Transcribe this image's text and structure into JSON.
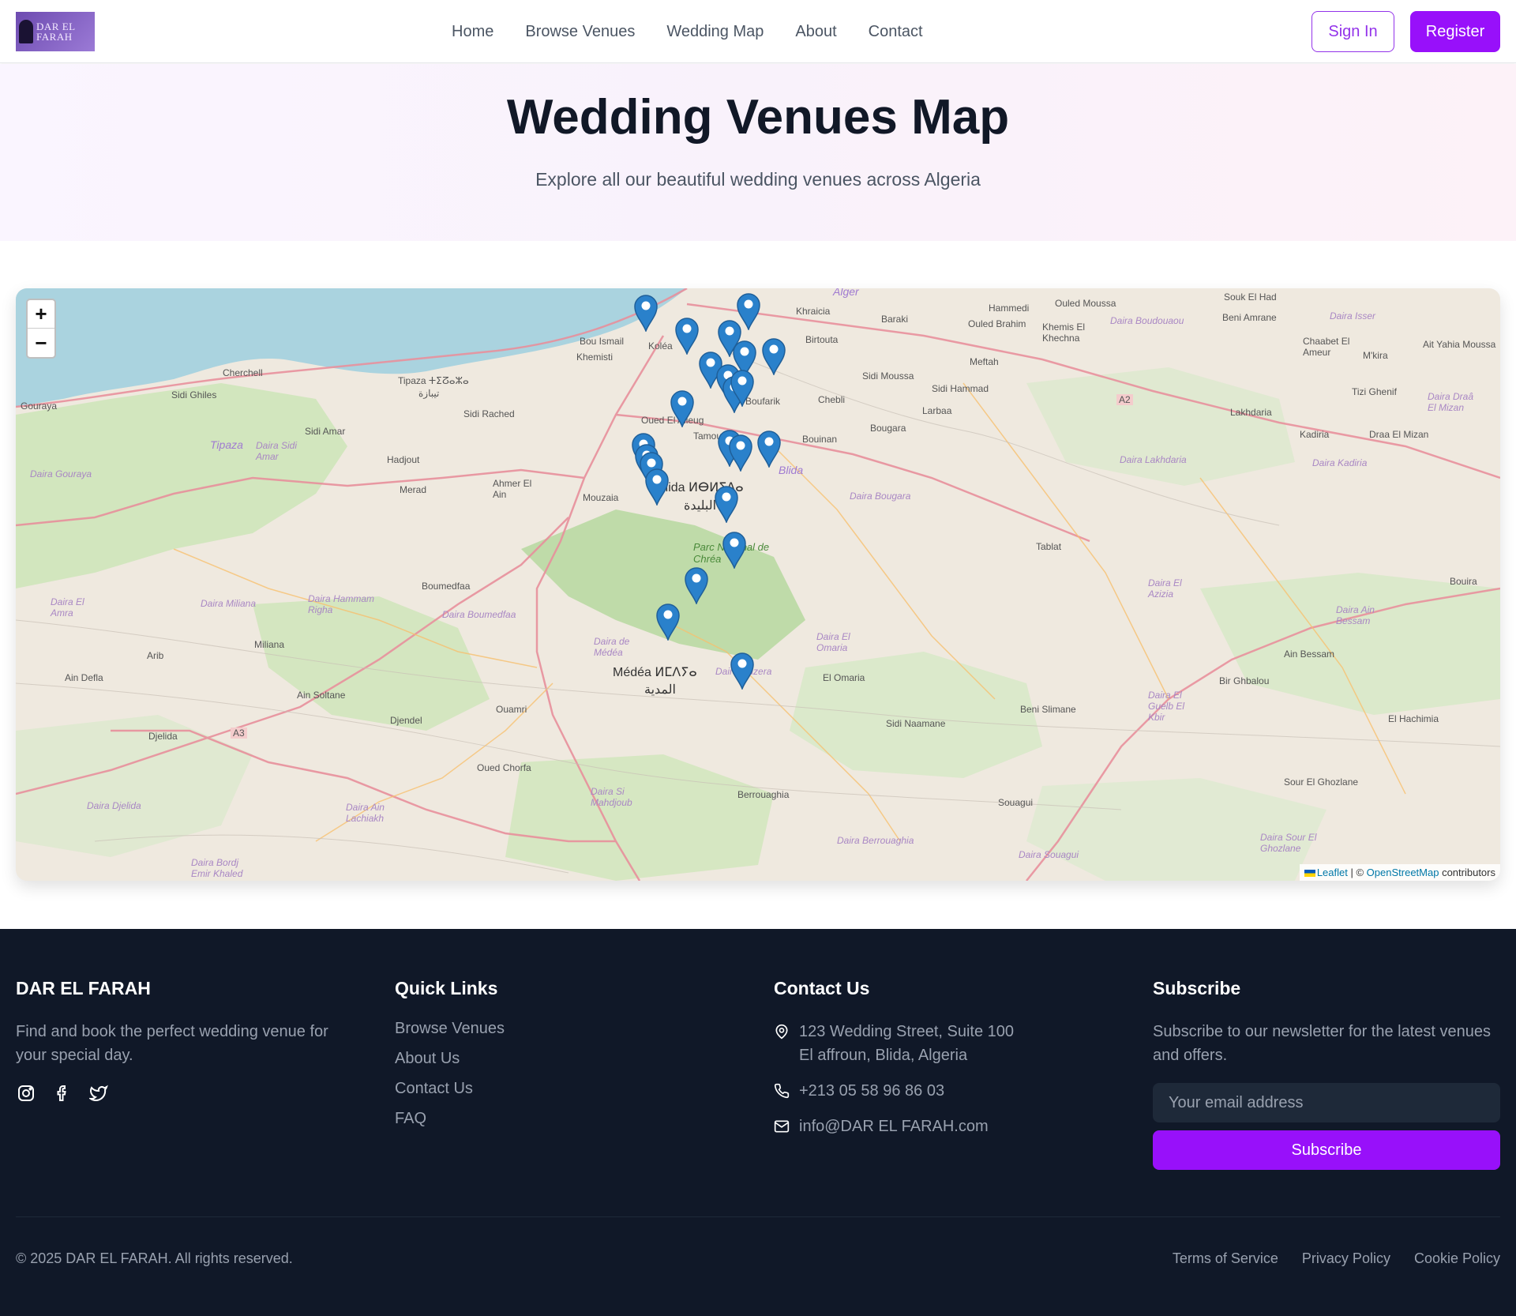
{
  "brand": {
    "logo_line1": "DAR EL",
    "logo_line2": "FARAH",
    "name": "DAR EL FARAH"
  },
  "nav": {
    "items": [
      "Home",
      "Browse Venues",
      "Wedding Map",
      "About",
      "Contact"
    ],
    "sign_in": "Sign In",
    "register": "Register"
  },
  "hero": {
    "title": "Wedding Venues Map",
    "subtitle": "Explore all our beautiful wedding venues across Algeria"
  },
  "map": {
    "zoom_in": "+",
    "zoom_out": "−",
    "attribution": {
      "leaflet": "Leaflet",
      "sep": " | © ",
      "osm": "OpenStreetMap",
      "suffix": " contributors"
    },
    "labels": {
      "alger": "Alger",
      "kolea": "Koléa",
      "bou_ismail": "Bou Ismail",
      "khemisti": "Khemisti",
      "cherchell": "Cherchell",
      "sidi_ghiles": "Sidi Ghiles",
      "gouraya": "Gouraya",
      "tipaza": "Tipaza ⵜⵉⵒⴰⵣⴰ",
      "tipaza_ar": "تيبازة",
      "sidi_rached": "Sidi Rached",
      "sidi_amar": "Sidi Amar",
      "hadjout": "Hadjout",
      "merad": "Merad",
      "ahmer_el_ain": "Ahmer El Ain",
      "mouzaia": "Mouzaia",
      "blida": "Blida ⵍⴱⵍⵉⴷⴰ",
      "blida_ar": "البليدة",
      "oued_el_alleug": "Oued El Alleug",
      "tamou": "Tamou",
      "boufarik": "Boufarik",
      "khraicia": "Khraicia",
      "birtouta": "Birtouta",
      "baraki": "Baraki",
      "chebli": "Chebli",
      "bouinan": "Bouinan",
      "bougara": "Bougara",
      "sidi_moussa": "Sidi Moussa",
      "larbaa": "Larbaa",
      "meftah": "Meftah",
      "sidi_hammad": "Sidi Hammad",
      "hammedi": "Hammedi",
      "ouled_moussa": "Ouled Moussa",
      "ouled_brahim": "Ouled Brahim",
      "khemis_el_khechna": "Khemis El Khechna",
      "souk_el_had": "Souk El Had",
      "beni_amrane": "Beni Amrane",
      "chaabet_el_ameur": "Chaabet El Ameur",
      "mkira": "M'kira",
      "ait_yahia_moussa": "Ait Yahia Moussa",
      "tizi_ghenif": "Tizi Ghenif",
      "lakhdaria": "Lakhdaria",
      "kadiria": "Kadiria",
      "draa_el_mizan": "Draa El Mizan",
      "tablat": "Tablat",
      "bouira": "Bouira",
      "ain_bessam": "Ain Bessam",
      "bir_ghbalou": "Bir Ghbalou",
      "el_hachimia": "El Hachimia",
      "sour_el_ghozlane": "Sour El Ghozlane",
      "beni_slimane": "Beni Slimane",
      "sidi_naamane": "Sidi Naamane",
      "el_omaria": "El Omaria",
      "souagui": "Souagui",
      "berrouaghia": "Berrouaghia",
      "medea": "Médéa ⵍⵎⴷⵢⴰ",
      "medea_ar": "المدية",
      "ouamri": "Ouamri",
      "ouled_chorfa": "Oued Chorfa",
      "djendel": "Djendel",
      "ain_soltane": "Ain Soltane",
      "boumedfaa": "Boumedfaa",
      "miliana": "Miliana",
      "arib": "Arib",
      "ain_defla": "Ain Defla",
      "djelida": "Djelida",
      "a3": "A3",
      "a2": "A2",
      "chrea": "Parc National de Chréa",
      "blida_wilaya": "Blida",
      "d_tipaza": "Tipaza",
      "d_sidi_amar": "Daira Sidi Amar",
      "d_gouraya": "Daira Gouraya",
      "d_el_affroun": "Daira El Amra",
      "d_miliana": "Daira Miliana",
      "d_hammam_righa": "Daira Hammam Righa",
      "d_boumedfaa": "Daira Boumedfaa",
      "d_medea": "Daira de Médéa",
      "d_ouzera": "Daira Ouzera",
      "d_el_omaria": "Daira El Omaria",
      "d_bougara": "Daira Bougara",
      "d_lakhdaria": "Daira Lakhdaria",
      "d_kadiria": "Daira Kadiria",
      "d_el_azizia": "Daira El Azizia",
      "d_ain_bessam": "Daira Ain Bessam",
      "d_el_guelb": "Daira El Guelb El Kbir",
      "d_si_mahdjoub": "Daira Si Mahdjoub",
      "d_berrouaghia": "Daira Berrouaghia",
      "d_souagui": "Daira Souagui",
      "d_sour": "Daira Sour El Ghozlane",
      "d_djelida": "Daira Djelida",
      "d_ain_lechiakh": "Daira Ain Lachiakh",
      "d_bordj": "Daira Bordj Emir Khaled",
      "d_boudouaou": "Daira Boudouaou",
      "d_isser": "Daira Isser",
      "d_draa_el_mizan": "Daira Draâ El Mizan"
    }
  },
  "footer": {
    "brand_title": "DAR EL FARAH",
    "brand_text": "Find and book the perfect wedding venue for your special day.",
    "quick_links_title": "Quick Links",
    "quick_links": [
      "Browse Venues",
      "About Us",
      "Contact Us",
      "FAQ"
    ],
    "contact_title": "Contact Us",
    "address_line1": "123 Wedding Street, Suite 100",
    "address_line2": "El affroun, Blida, Algeria",
    "phone": "+213 05 58 96 86 03",
    "email": "info@DAR EL FARAH.com",
    "subscribe_title": "Subscribe",
    "subscribe_text": "Subscribe to our newsletter for the latest venues and offers.",
    "email_placeholder": "Your email address",
    "subscribe_button": "Subscribe",
    "copyright": "© 2025 DAR EL FARAH. All rights reserved.",
    "legal": [
      "Terms of Service",
      "Privacy Policy",
      "Cookie Policy"
    ]
  },
  "colors": {
    "accent": "#9810fa",
    "footer_bg": "#101828",
    "marker": "#2a81cb"
  },
  "icons": [
    "logo-icon",
    "zoom-in-icon",
    "zoom-out-icon",
    "map-marker-icon",
    "instagram-icon",
    "facebook-icon",
    "twitter-icon",
    "location-pin-icon",
    "phone-icon",
    "mail-icon"
  ]
}
